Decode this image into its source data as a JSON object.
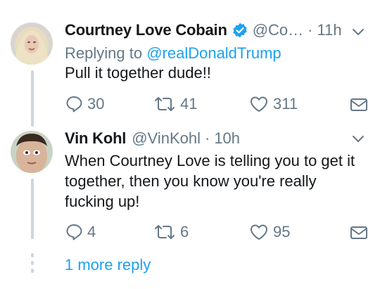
{
  "tweets": [
    {
      "name": "Courtney Love Cobain",
      "handle": "@Co…",
      "separator": "·",
      "time": "11h",
      "replying_prefix": "Replying to ",
      "replying_to": "@realDonaldTrump",
      "text": "Pull it together dude!!",
      "replies": "30",
      "retweets": "41",
      "likes": "311",
      "verified": true
    },
    {
      "name": "Vin Kohl",
      "handle": "@VinKohl",
      "separator": "·",
      "time": "10h",
      "text": "When Courtney Love is telling you to get it together, then you know you're really fucking up!",
      "replies": "4",
      "retweets": "6",
      "likes": "95",
      "verified": false
    }
  ],
  "more_replies_label": "1 more reply",
  "colors": {
    "text": "#14171a",
    "secondary": "#657786",
    "link": "#1da1f2",
    "thread_line": "#ccd6dd"
  }
}
